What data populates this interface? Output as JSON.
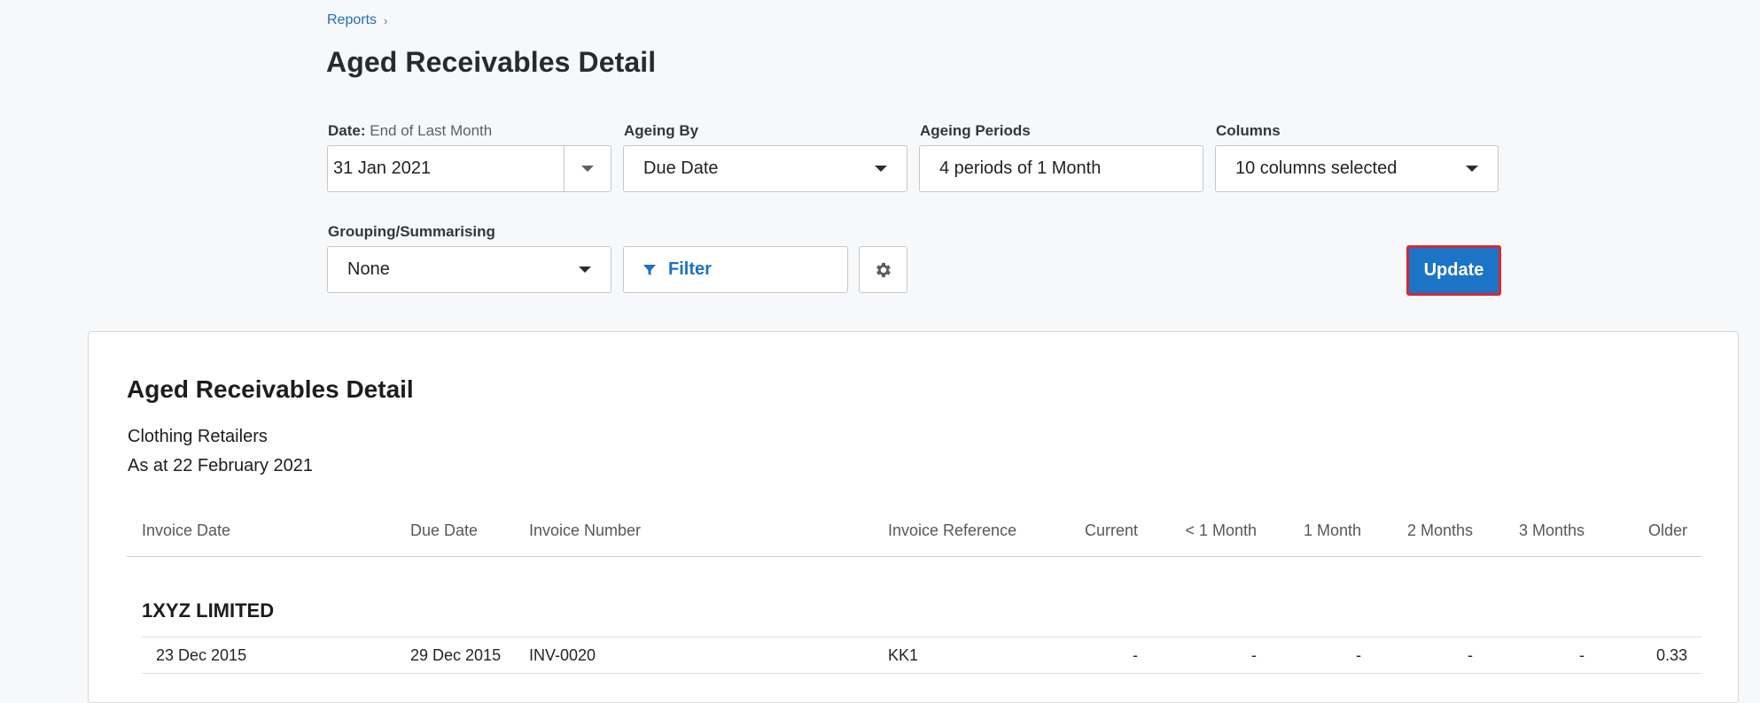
{
  "breadcrumb": {
    "reports_label": "Reports",
    "separator": "›"
  },
  "page": {
    "title": "Aged Receivables Detail"
  },
  "filters": {
    "date": {
      "label": "Date:",
      "sub_label": "End of Last Month",
      "value": "31 Jan 2021"
    },
    "ageing_by": {
      "label": "Ageing By",
      "value": "Due Date"
    },
    "ageing_periods": {
      "label": "Ageing Periods",
      "value": "4 periods of 1 Month"
    },
    "columns": {
      "label": "Columns",
      "value": "10 columns selected"
    },
    "grouping": {
      "label": "Grouping/Summarising",
      "value": "None"
    },
    "filter_button": {
      "label": "Filter",
      "icon": "filter-icon"
    },
    "settings_button": {
      "icon": "gear-icon"
    },
    "update_button": {
      "label": "Update"
    }
  },
  "report": {
    "title": "Aged Receivables Detail",
    "organisation": "Clothing Retailers",
    "as_at": "As at 22 February 2021",
    "columns": [
      "Invoice Date",
      "Due Date",
      "Invoice Number",
      "Invoice Reference",
      "Current",
      "< 1 Month",
      "1 Month",
      "2 Months",
      "3 Months",
      "Older"
    ],
    "groups": [
      {
        "name": "1XYZ LIMITED",
        "rows": [
          [
            "23 Dec 2015",
            "29 Dec 2015",
            "INV-0020",
            "KK1",
            "-",
            "-",
            "-",
            "-",
            "-",
            "0.33"
          ]
        ]
      }
    ]
  },
  "colors": {
    "accent": "#1c74c6",
    "link": "#1f6fb5",
    "update_border": "#d42a35"
  }
}
